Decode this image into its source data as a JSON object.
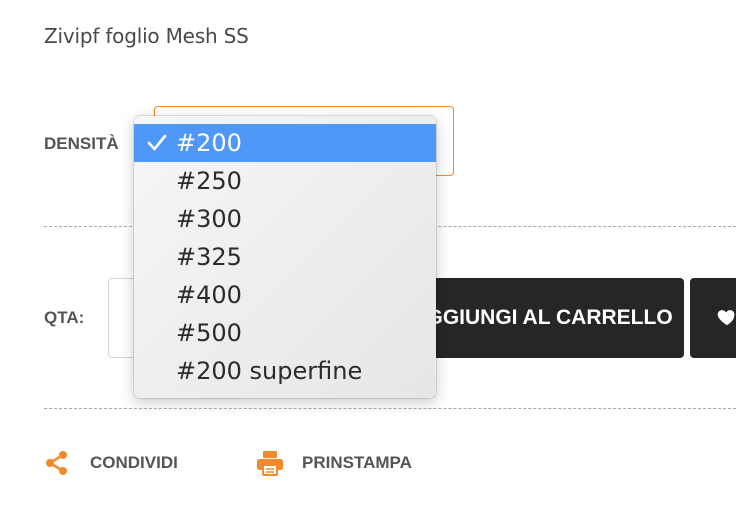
{
  "product": {
    "title": "Zivipf foglio Mesh SS"
  },
  "density": {
    "label": "DENSITÀ",
    "selected": "#200",
    "options": [
      "#200",
      "#250",
      "#300",
      "#325",
      "#400",
      "#500",
      "#200 superfine"
    ]
  },
  "quantity": {
    "label": "QTA:"
  },
  "cart": {
    "button_label": "AGGIUNGI AL CARRELLO"
  },
  "actions": {
    "share_label": "CONDIVIDI",
    "print_label": "PRINSTAMPA"
  },
  "colors": {
    "accent": "#f08a2c",
    "selected_option": "#4f98f7",
    "button_bg": "#262626"
  }
}
